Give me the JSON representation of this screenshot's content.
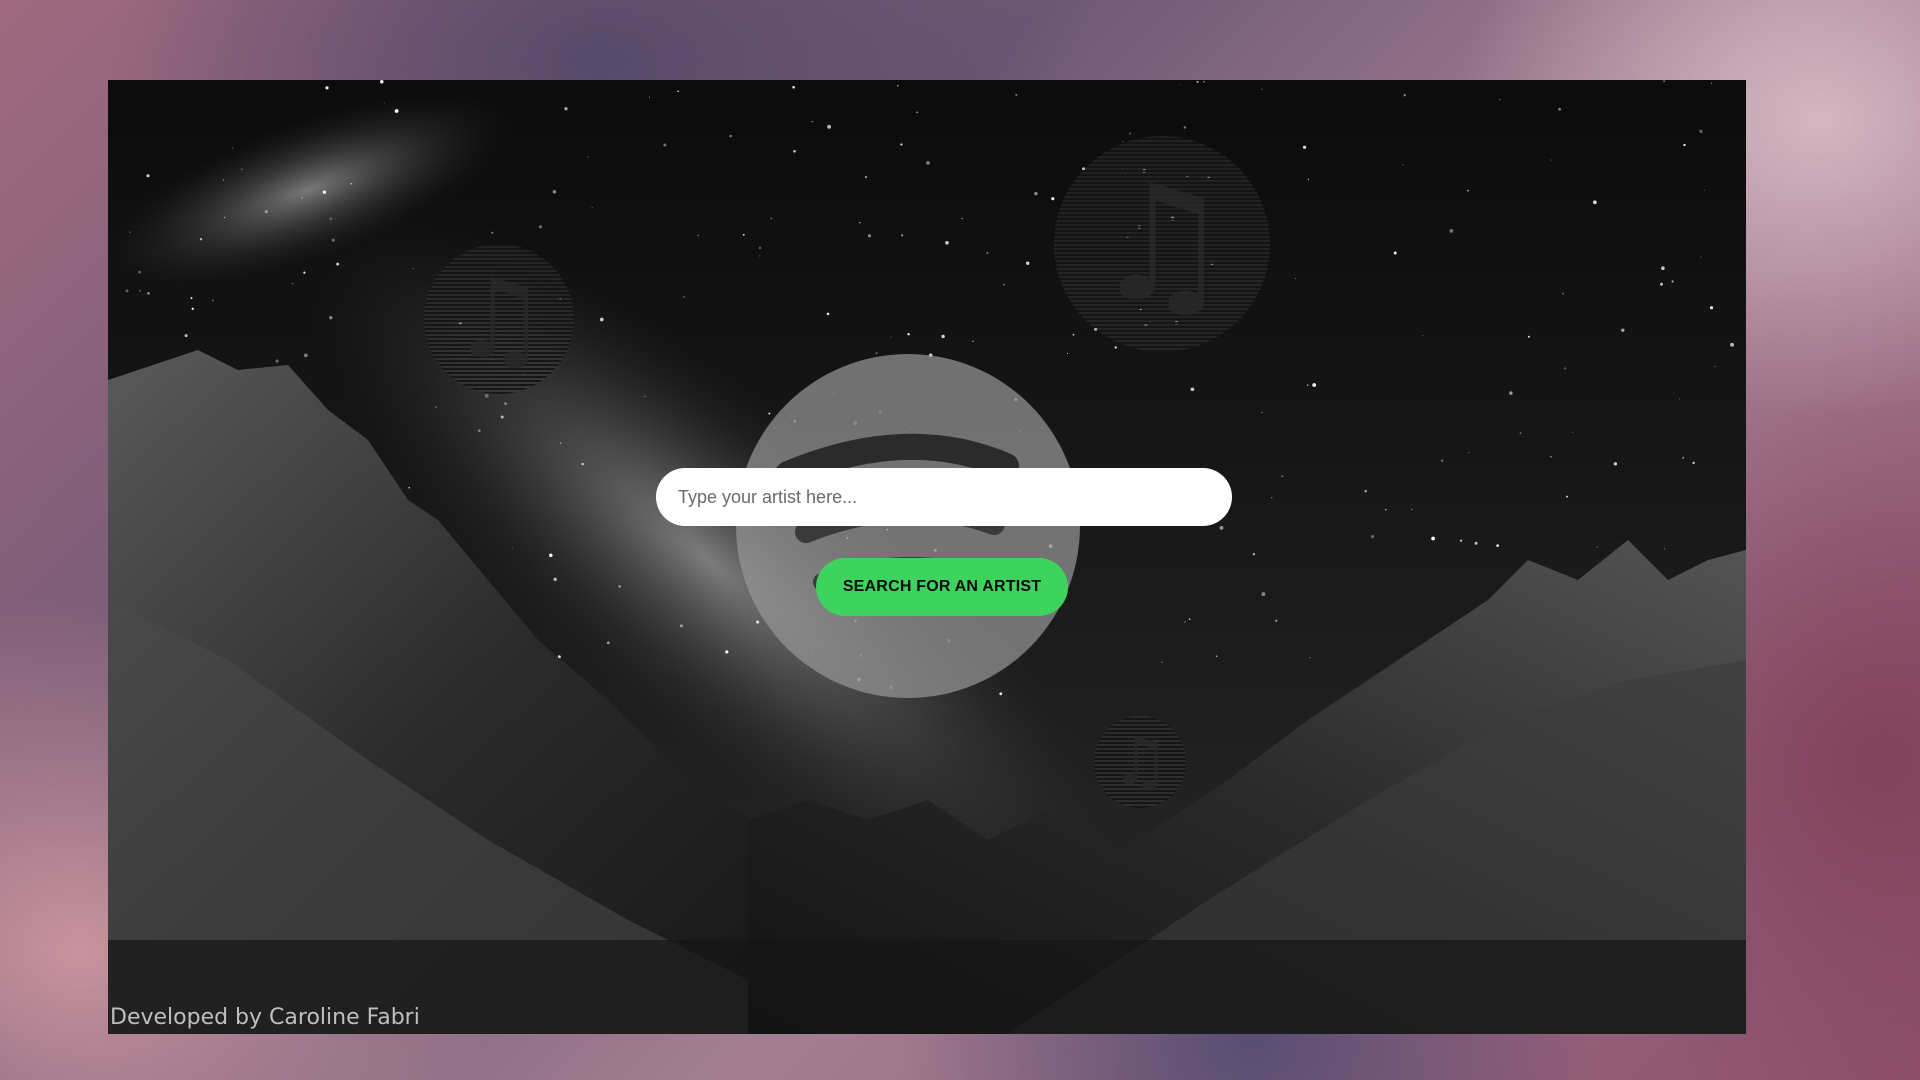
{
  "search": {
    "placeholder": "Type your artist here...",
    "value": ""
  },
  "actions": {
    "search_label": "SEARCH FOR AN ARTIST"
  },
  "footer": {
    "credit": "Developed by Caroline Fabri"
  },
  "decor": {
    "note_icon": "music-note-icon",
    "logo_icon": "spotify-logo-icon"
  },
  "colors": {
    "accent": "#3ed35e",
    "input_bg": "#ffffff",
    "footer_text": "#bfbfbf"
  }
}
